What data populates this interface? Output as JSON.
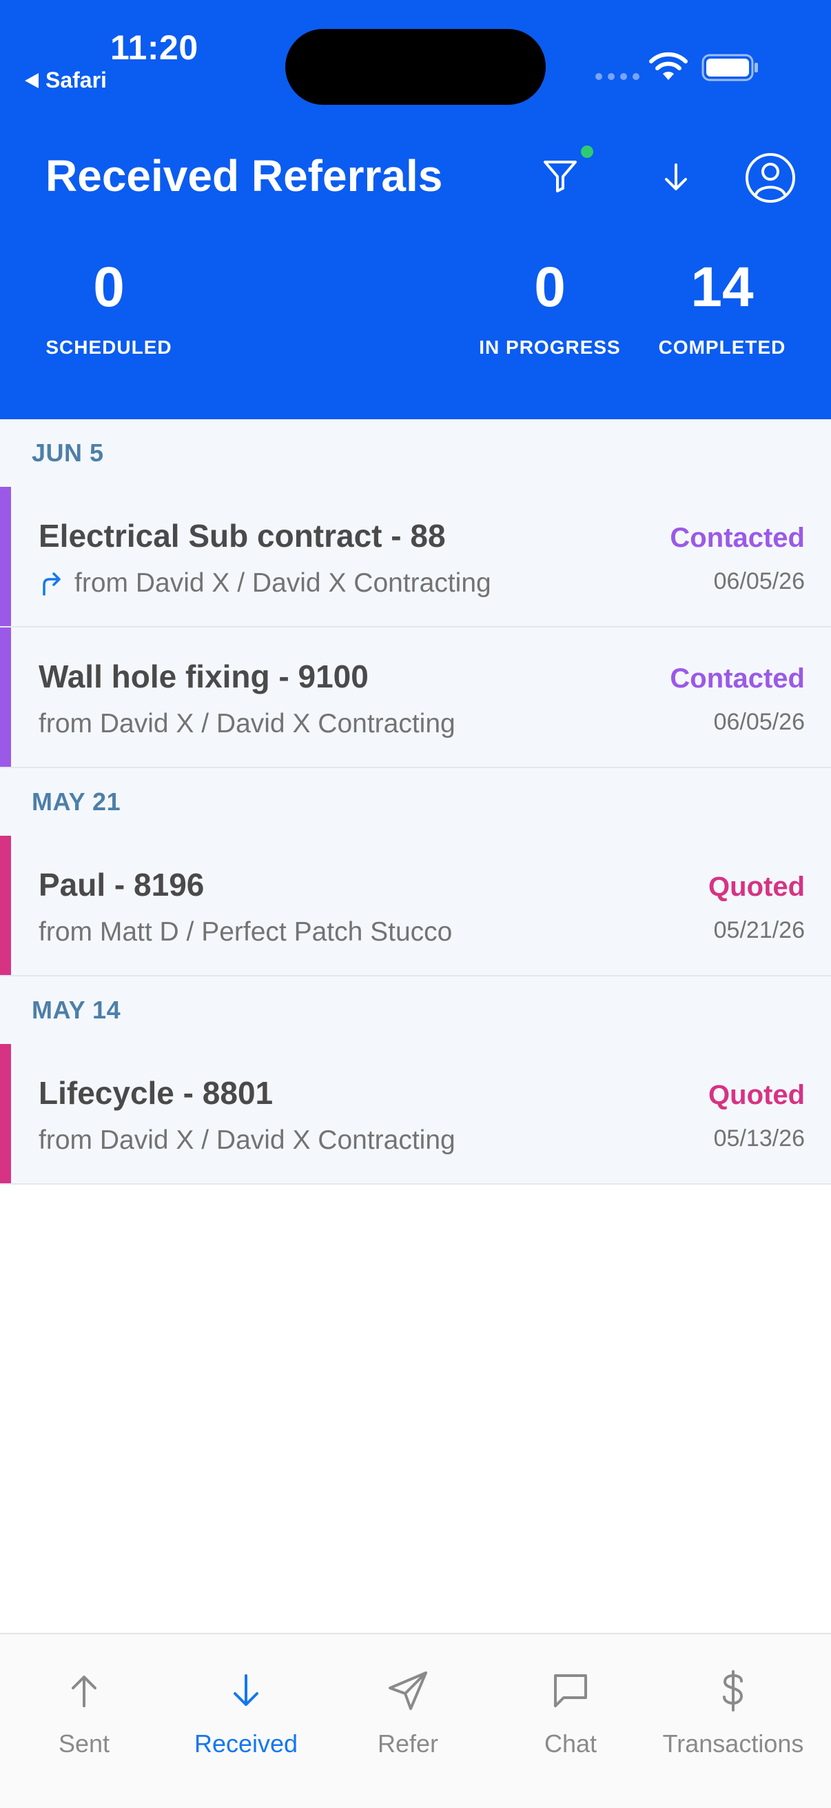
{
  "status_bar": {
    "time": "11:20",
    "back_app": "Safari"
  },
  "header": {
    "title": "Received Referrals",
    "stats": [
      {
        "value": "0",
        "label": "SCHEDULED"
      },
      {
        "value": "0",
        "label": "IN PROGRESS"
      },
      {
        "value": "14",
        "label": "COMPLETED"
      }
    ]
  },
  "sections": [
    {
      "date": "JUN 5",
      "items": [
        {
          "title": "Electrical Sub contract - 88",
          "from": "from David X / David X Contracting",
          "status": "Contacted",
          "date": "06/05/26",
          "status_color": "#9b59e8",
          "accent": "#9b59e8"
        },
        {
          "title": "Wall hole fixing - 9100",
          "from": "from David X / David X Contracting",
          "status": "Contacted",
          "date": "06/05/26",
          "status_color": "#9b59e8",
          "accent": "#9b59e8"
        }
      ]
    },
    {
      "date": "MAY 21",
      "items": [
        {
          "title": "Paul - 8196",
          "from": "from Matt D / Perfect Patch Stucco",
          "status": "Quoted",
          "date": "05/21/26",
          "status_color": "#d63384",
          "accent": "#d63384"
        }
      ]
    },
    {
      "date": "MAY 14",
      "items": [
        {
          "title": "Lifecycle - 8801",
          "from": "from David X / David X Contracting",
          "status": "Quoted",
          "date": "05/13/26",
          "status_color": "#d63384",
          "accent": "#d63384"
        }
      ]
    }
  ],
  "tabs": [
    {
      "label": "Sent",
      "icon": "arrow-up-icon"
    },
    {
      "label": "Received",
      "icon": "arrow-down-icon"
    },
    {
      "label": "Refer",
      "icon": "send-icon"
    },
    {
      "label": "Chat",
      "icon": "chat-icon"
    },
    {
      "label": "Transactions",
      "icon": "dollar-icon"
    }
  ],
  "colors": {
    "header_bg": "#0b5cf0",
    "active_tab": "#1577f0",
    "filter_indicator": "#2ecc71"
  }
}
